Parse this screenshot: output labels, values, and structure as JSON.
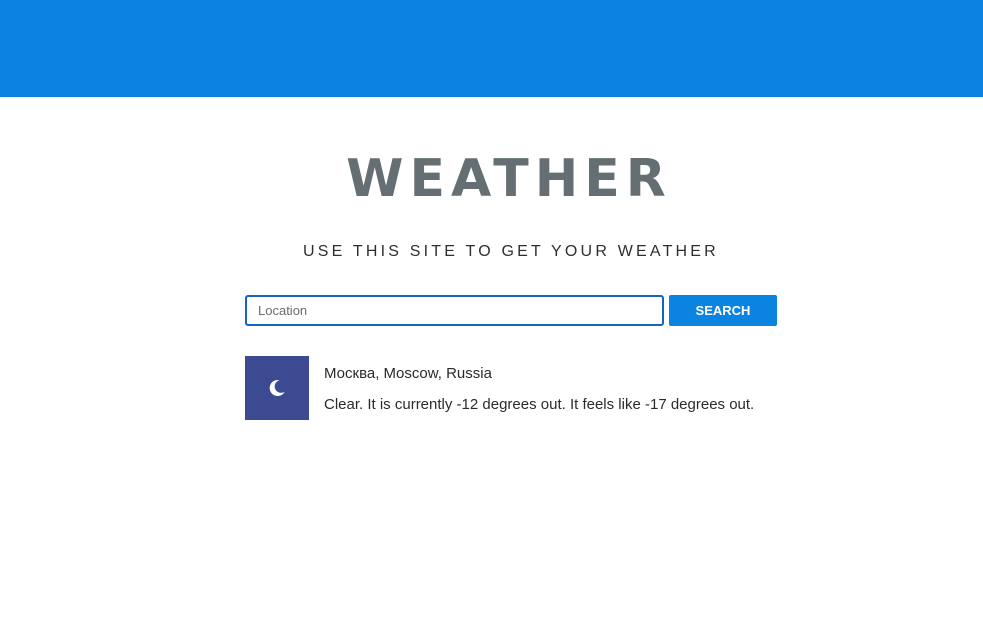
{
  "header": {
    "bar_color": "#0a84e0"
  },
  "main": {
    "title": "WEATHER",
    "subtitle": "USE THIS SITE TO GET YOUR WEATHER"
  },
  "search": {
    "placeholder": "Location",
    "value": "",
    "button_label": "SEARCH"
  },
  "result": {
    "icon": "moon-icon",
    "icon_background": "#3b4a91",
    "location": "Москва, Moscow, Russia",
    "conditions": "Clear. It is currently -12 degrees out. It feels like -17 degrees out."
  }
}
